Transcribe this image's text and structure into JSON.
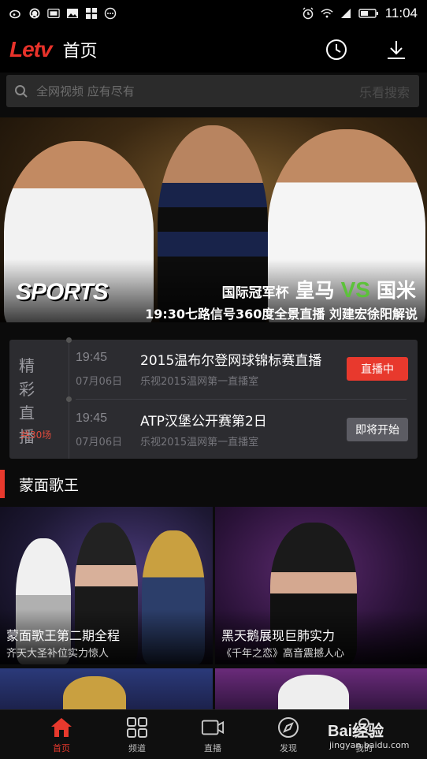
{
  "status_bar": {
    "time": "11:04"
  },
  "app": {
    "logo": "Letv",
    "title": "首页"
  },
  "search": {
    "placeholder": "全网视频 应有尽有",
    "button": "乐看搜索"
  },
  "banner": {
    "logo_text": "SPORTS",
    "cup": "国际冠军杯",
    "team_home": "皇马",
    "vs": "VS",
    "team_away": "国米",
    "subtitle": "19:30七路信号360度全景直播 刘建宏徐阳解说"
  },
  "live": {
    "title": "精彩直播",
    "count": "共30场",
    "items": [
      {
        "time": "19:45",
        "date": "07月06日",
        "title": "2015温布尔登网球锦标赛直播",
        "room": "乐视2015温网第一直播室",
        "status": "直播中"
      },
      {
        "time": "19:45",
        "date": "07月06日",
        "title": "ATP汉堡公开赛第2日",
        "room": "乐视2015温网第一直播室",
        "status": "即将开始"
      }
    ]
  },
  "section": {
    "title": "蒙面歌王"
  },
  "videos": [
    {
      "title": "蒙面歌王第二期全程",
      "subtitle": "齐天大圣补位实力惊人"
    },
    {
      "title": "黑天鹅展现巨肺实力",
      "subtitle": "《千年之恋》高音震撼人心"
    },
    {
      "title": "",
      "subtitle": ""
    },
    {
      "title": "",
      "subtitle": ""
    }
  ],
  "nav": [
    {
      "label": "首页",
      "icon": "home-icon"
    },
    {
      "label": "频道",
      "icon": "grid-icon"
    },
    {
      "label": "直播",
      "icon": "camera-icon"
    },
    {
      "label": "发现",
      "icon": "compass-icon"
    },
    {
      "label": "我的",
      "icon": "user-icon"
    }
  ],
  "watermark": {
    "main": "Bai经验",
    "sub": "jingyan.baidu.com"
  },
  "colors": {
    "accent": "#e8392d",
    "brand": "#e8322a",
    "vs_green": "#5cc23a"
  }
}
